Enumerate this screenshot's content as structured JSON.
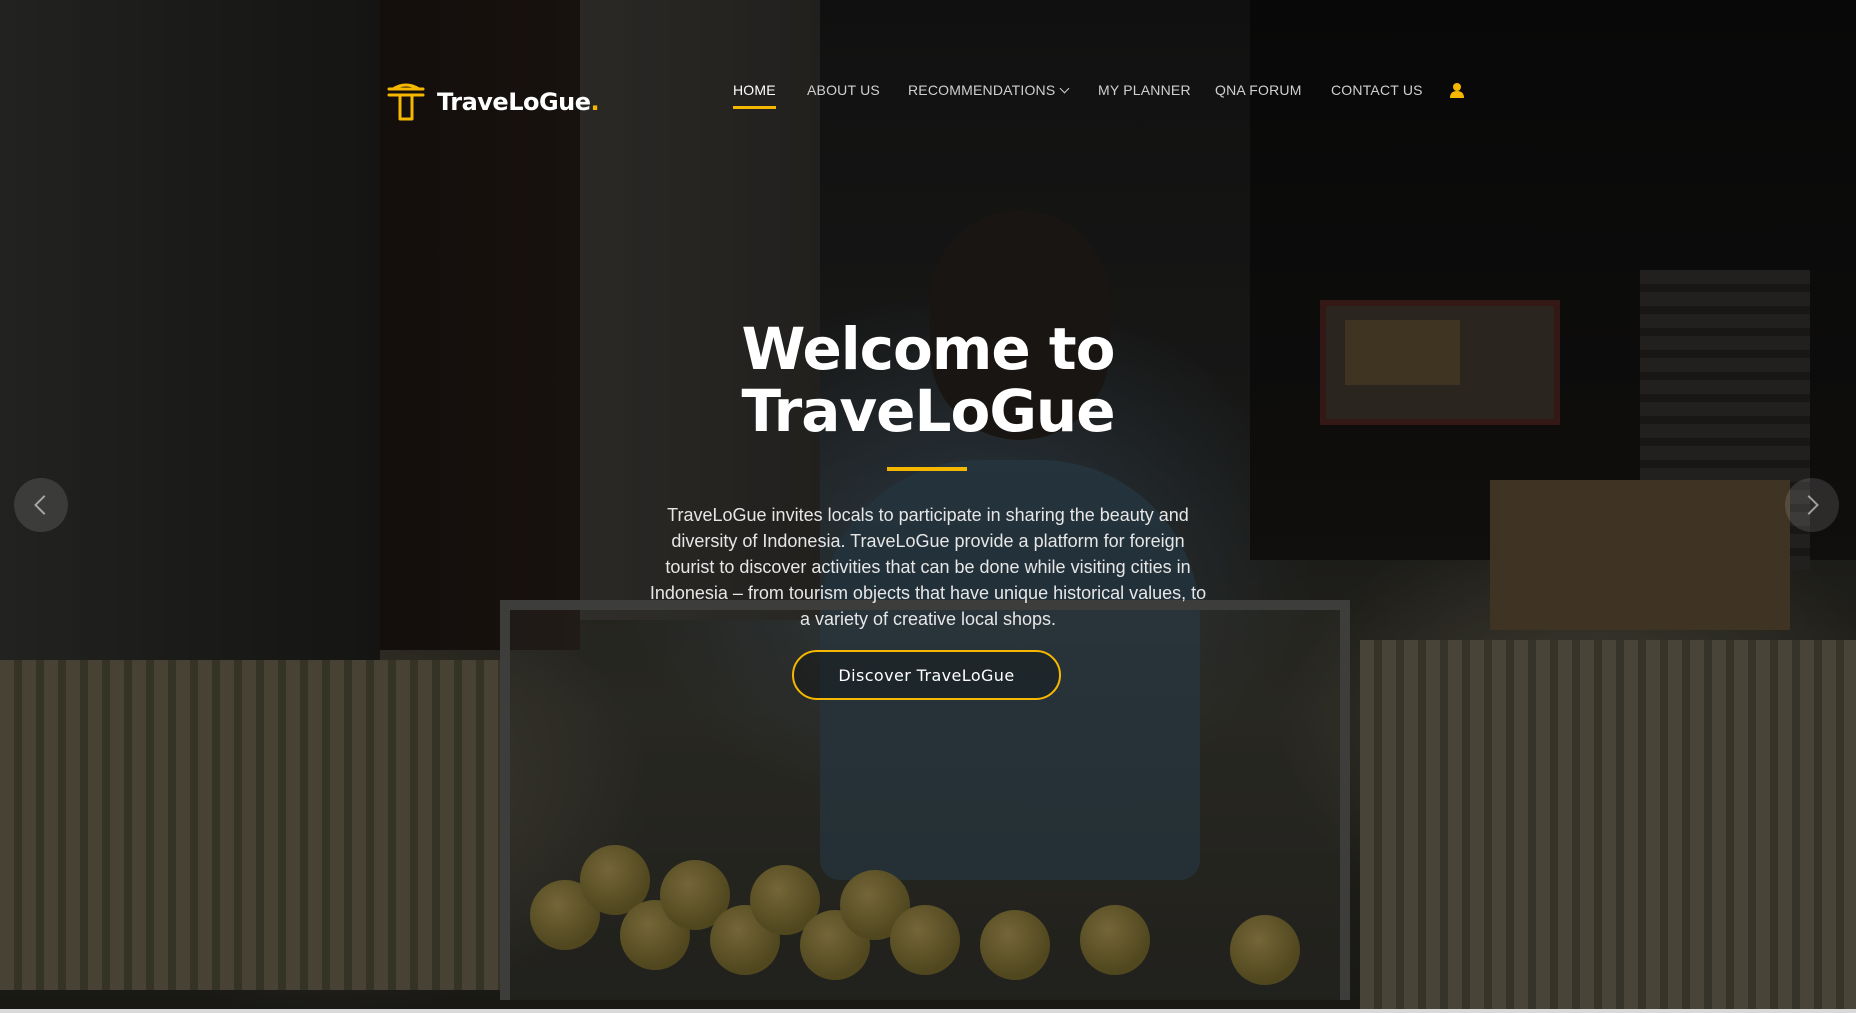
{
  "brand": {
    "name": "TraveLoGue",
    "dot": ".",
    "logo_icon": "traveloGue-t-logo-icon",
    "accent_color": "#f5b700"
  },
  "nav": {
    "items": [
      {
        "label": "HOME",
        "active": true
      },
      {
        "label": "ABOUT US"
      },
      {
        "label": "RECOMMENDATIONS",
        "has_dropdown": true,
        "icon": "chevron-down-icon"
      },
      {
        "label": "MY PLANNER"
      },
      {
        "label": "QNA FORUM"
      },
      {
        "label": "CONTACT US"
      }
    ],
    "user_icon": "user-icon"
  },
  "hero": {
    "headline": "Welcome to TraveLoGue",
    "description": "TraveLoGue invites locals to participate in sharing the beauty and diversity of Indonesia. TraveLoGue provide a platform for foreign tourist to discover activities that can be done while visiting cities in Indonesia – from tourism objects that have unique historical values, to a variety of creative local shops.",
    "cta_label": "Discover TraveLoGue",
    "prev_icon": "chevron-left-icon",
    "next_icon": "chevron-right-icon"
  }
}
